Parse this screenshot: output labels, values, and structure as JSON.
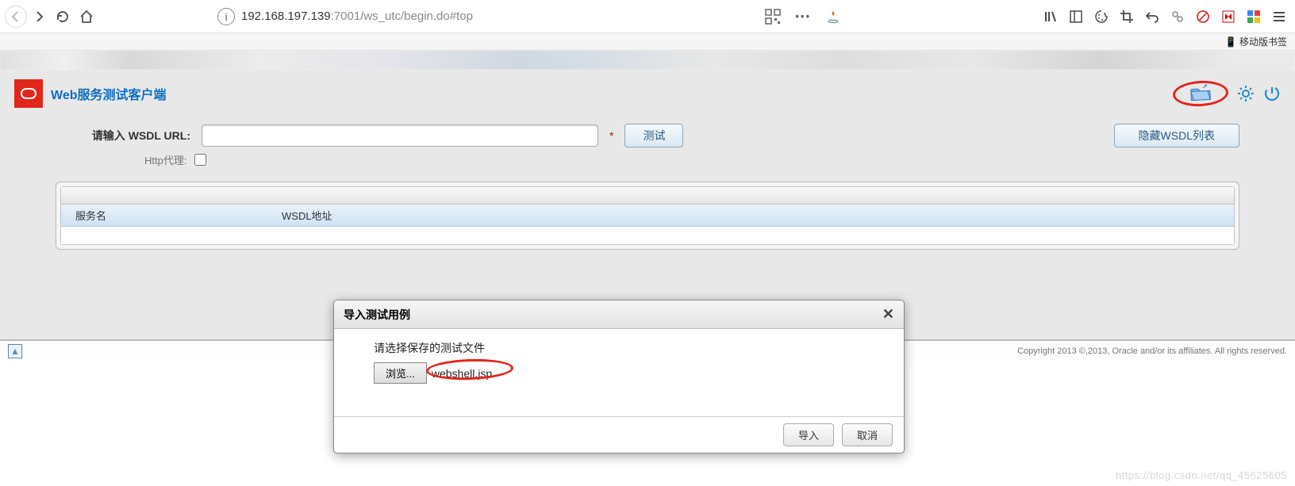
{
  "browser": {
    "url_host": "192.168.197.139",
    "url_port_path": ":7001/ws_utc/begin.do#top",
    "bookmark_label": "移动版书签"
  },
  "header": {
    "app_title": "Web服务测试客户端"
  },
  "form": {
    "wsdl_label": "请输入 WSDL URL:",
    "test_btn": "测试",
    "hide_btn": "隐藏WSDL列表",
    "proxy_label": "Http代理:"
  },
  "table": {
    "col_service": "服务名",
    "col_wsdl": "WSDL地址"
  },
  "footer": {
    "copyright": "Copyright 2013 ©,2013, Oracle and/or its affiliates. All rights reserved."
  },
  "dialog": {
    "title": "导入测试用例",
    "prompt": "请选择保存的测试文件",
    "browse": "浏览...",
    "filename": "webshell.jsp",
    "import_btn": "导入",
    "cancel_btn": "取消"
  },
  "watermark": "https://blog.csdn.net/qq_45625605"
}
